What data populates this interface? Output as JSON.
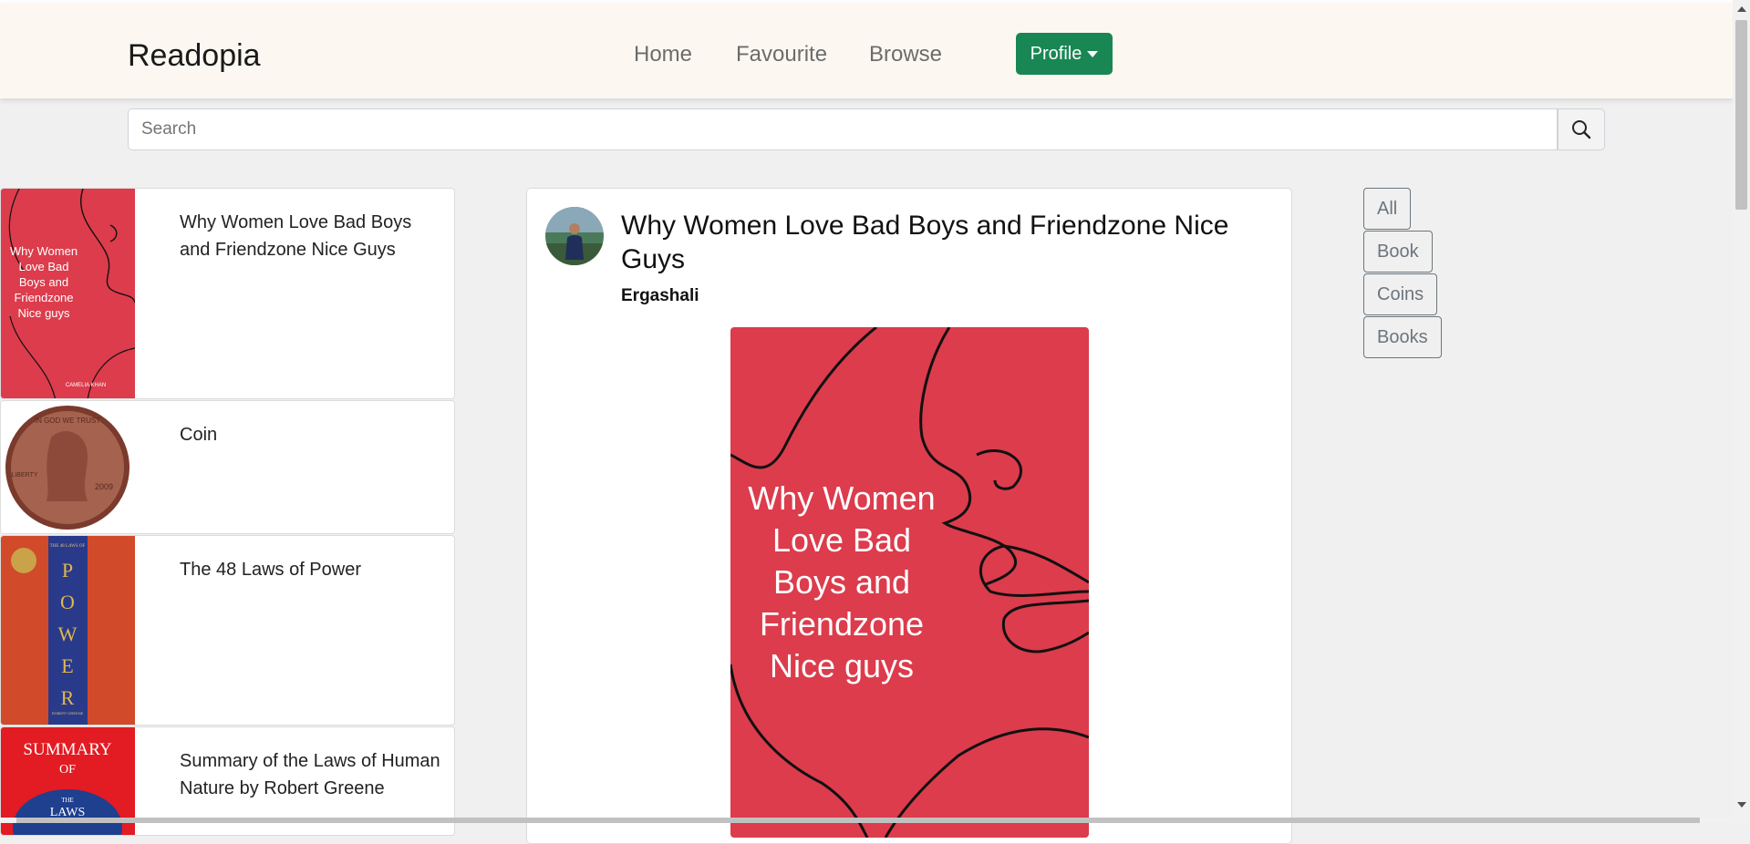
{
  "navbar": {
    "brand": "Readopia",
    "links": [
      {
        "label": "Home"
      },
      {
        "label": "Favourite"
      },
      {
        "label": "Browse"
      }
    ],
    "profile_label": "Profile"
  },
  "search": {
    "placeholder": "Search",
    "value": ""
  },
  "books": [
    {
      "title": "Why Women Love Bad Boys and Friendzone Nice Guys",
      "cover": "red-book-cover"
    },
    {
      "title": "Coin",
      "cover": "penny-coin"
    },
    {
      "title": "The 48 Laws of Power",
      "cover": "power-book-cover"
    },
    {
      "title": "Summary of the Laws of Human Nature by Robert Greene",
      "cover": "summary-book-cover"
    }
  ],
  "thumb_text": {
    "red_title": [
      "Why Women",
      "Love Bad",
      "Boys and",
      "Friendzone",
      "Nice guys"
    ],
    "red_author": "CAMELIA KHAN",
    "coin_top": "IN GOD WE TRUST",
    "coin_left": "LIBERTY",
    "coin_year": "2009",
    "power_letters": [
      "P",
      "O",
      "W",
      "E",
      "R"
    ],
    "power_top": "THE 48 LAWS OF",
    "power_author": "ROBERT GREENE",
    "summary_line1": "SUMMARY",
    "summary_line2": "OF",
    "summary_line3": "THE",
    "summary_line4": "LAWS"
  },
  "post": {
    "title": "Why Women Love Bad Boys and Friendzone Nice Guys",
    "author": "Ergashali",
    "cover_lines": [
      "Why Women",
      "Love Bad",
      "Boys and",
      "Friendzone",
      "Nice guys"
    ]
  },
  "filters": [
    {
      "label": "All"
    },
    {
      "label": "Book"
    },
    {
      "label": "Coins"
    },
    {
      "label": "Books"
    }
  ],
  "colors": {
    "brand_green": "#198754",
    "navbar_bg": "#fcf8f1",
    "cover_red": "#dc3c4c"
  }
}
